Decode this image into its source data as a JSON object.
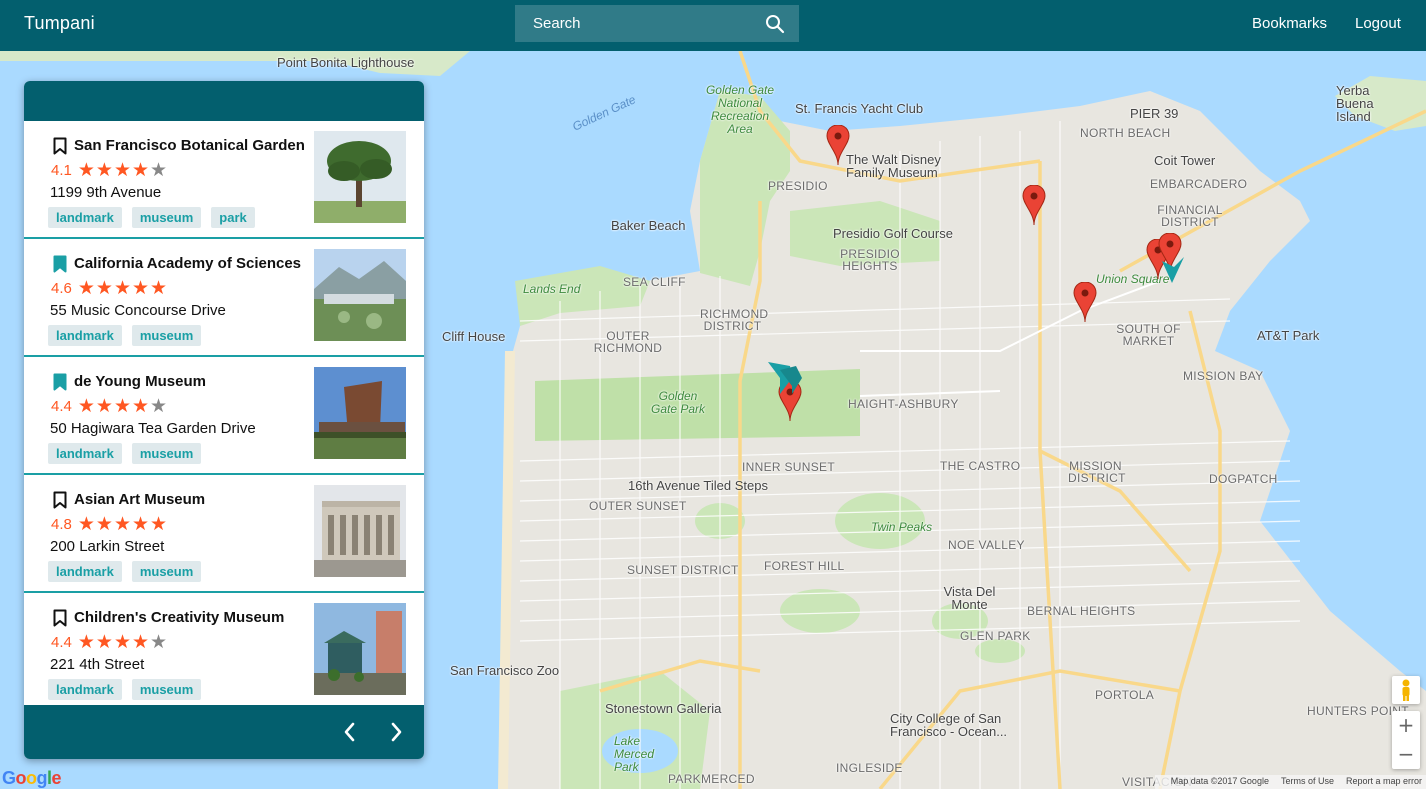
{
  "header": {
    "brand": "Tumpani",
    "search_placeholder": "Search",
    "nav": {
      "bookmarks": "Bookmarks",
      "logout": "Logout"
    }
  },
  "colors": {
    "header": "#035f6e",
    "accent": "#1a9fa5",
    "star": "#ff5722",
    "tag_bg": "#dfe9ec"
  },
  "results": [
    {
      "name": "San Francisco Botanical Garden",
      "rating": "4.1",
      "stars": 4,
      "address": "1199 9th Avenue",
      "bookmarked": false,
      "tags": [
        "landmark",
        "museum",
        "park"
      ]
    },
    {
      "name": "California Academy of Sciences",
      "rating": "4.6",
      "stars": 5,
      "address": "55 Music Concourse Drive",
      "bookmarked": true,
      "tags": [
        "landmark",
        "museum"
      ]
    },
    {
      "name": "de Young Museum",
      "rating": "4.4",
      "stars": 4,
      "address": "50 Hagiwara Tea Garden Drive",
      "bookmarked": true,
      "tags": [
        "landmark",
        "museum"
      ]
    },
    {
      "name": "Asian Art Museum",
      "rating": "4.8",
      "stars": 5,
      "address": "200 Larkin Street",
      "bookmarked": false,
      "tags": [
        "landmark",
        "museum"
      ]
    },
    {
      "name": "Children's Creativity Museum",
      "rating": "4.4",
      "stars": 4,
      "address": "221 4th Street",
      "bookmarked": false,
      "tags": [
        "landmark",
        "museum"
      ]
    }
  ],
  "map": {
    "labels": {
      "point_bonita": "Point Bonita Lighthouse",
      "golden_gate_water": "Golden Gate",
      "gg_nra": "Golden Gate National Recreation Area",
      "st_francis": "St. Francis Yacht Club",
      "pier39": "PIER 39",
      "yerba_buena": "Yerba Buena Island",
      "north_beach": "NORTH BEACH",
      "coit_tower": "Coit Tower",
      "walt_disney": "The Walt Disney Family Museum",
      "presidio": "PRESIDIO",
      "embarcadero": "EMBARCADERO",
      "financial_district": "FINANCIAL DISTRICT",
      "baker_beach": "Baker Beach",
      "presidio_golf": "Presidio Golf Course",
      "presidio_heights": "PRESIDIO HEIGHTS",
      "sea_cliff": "SEA CLIFF",
      "lands_end": "Lands End",
      "union_square": "Union Square",
      "richmond": "RICHMOND DISTRICT",
      "outer_richmond": "OUTER RICHMOND",
      "cliff_house": "Cliff House",
      "south_of_market": "SOUTH OF MARKET",
      "att_park": "AT&T Park",
      "mission_bay": "MISSION BAY",
      "golden_gate_park": "Golden Gate Park",
      "haight": "HAIGHT-ASHBURY",
      "inner_sunset": "INNER SUNSET",
      "castro": "THE CASTRO",
      "mission": "MISSION DISTRICT",
      "dogpatch": "DOGPATCH",
      "tiled_steps": "16th Avenue Tiled Steps",
      "outer_sunset": "OUTER SUNSET",
      "twin_peaks": "Twin Peaks",
      "noe_valley": "NOE VALLEY",
      "sunset": "SUNSET DISTRICT",
      "forest_hill": "FOREST HILL",
      "vista_del_monte": "Vista Del Monte",
      "bernal": "BERNAL HEIGHTS",
      "glen_park": "GLEN PARK",
      "sf_zoo": "San Francisco Zoo",
      "stonestown": "Stonestown Galleria",
      "portola": "PORTOLA",
      "hunters_point": "HUNTERS POINT",
      "city_college": "City College of San Francisco - Ocean...",
      "lake_merced": "Lake Merced Park",
      "ingleside": "INGLESIDE",
      "parkmerced": "PARKMERCED",
      "visitacion": "VISITACION"
    },
    "footer": {
      "data": "Map data ©2017 Google",
      "terms": "Terms of Use",
      "report": "Report a map error"
    },
    "google": "Google"
  }
}
